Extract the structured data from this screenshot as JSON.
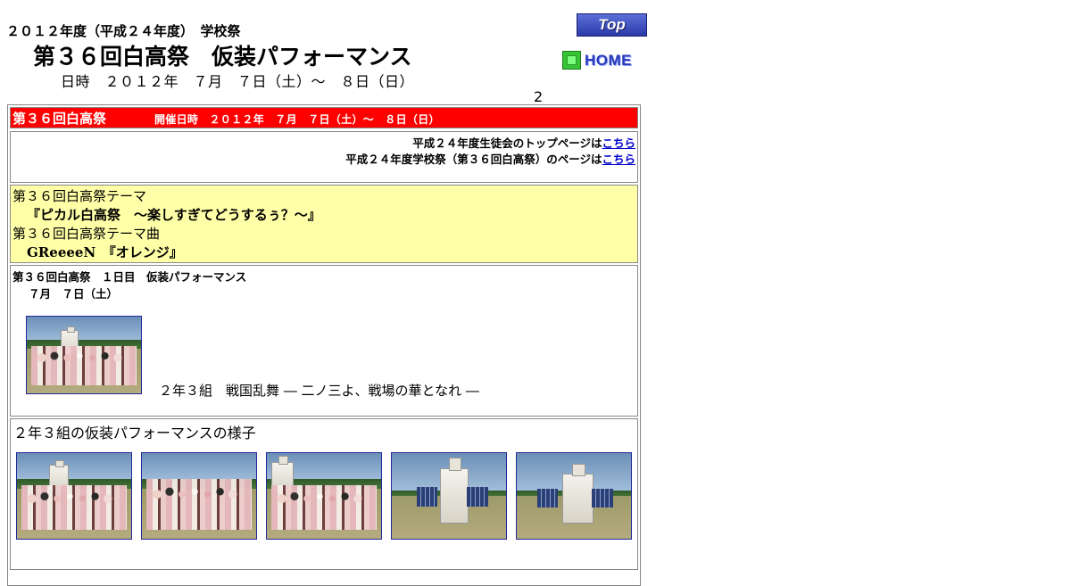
{
  "header": {
    "year_line": "２０１２年度（平成２４年度）　学校祭",
    "title": "第３６回白高祭　仮装パフォーマンス",
    "date_line": "日時　２０１２年　７月　７日（土）～　８日（日）",
    "counter": "2"
  },
  "nav": {
    "top_label": "Top",
    "home_label": "HOME"
  },
  "red_bar": {
    "title": "第３６回白高祭",
    "dates": "開催日時　２０１２年　７月　７日（土）～　８日（日）"
  },
  "links": {
    "row1_text": "平成２４年度生徒会のトップページは",
    "row1_link": "こちら",
    "row2_text": "平成２４年度学校祭（第３６回白高祭）のページは",
    "row2_link": "こちら"
  },
  "theme": {
    "theme_label": "第３６回白高祭テーマ",
    "theme_value": "『ピカル白高祭　～楽しすぎてどうするぅ？～』",
    "song_label": "第３６回白高祭テーマ曲",
    "song_artist": "GReeeeN",
    "song_title": "『オレンジ』"
  },
  "day1": {
    "heading": "第３６回白高祭　１日目　仮装パフォーマンス",
    "date": "７月　７日（土）",
    "caption": "２年３組　戦国乱舞 ― 二ノ三よ、戦場の華となれ ―"
  },
  "gallery": {
    "title": "２年３組の仮装パフォーマンスの様子",
    "photos": [
      "class-group-photo",
      "class-group-photo",
      "class-group-photo",
      "castle-prop-photo",
      "castle-prop-photo"
    ]
  },
  "colors": {
    "red_bar": "#ff0000",
    "theme_bg": "#ffffa8",
    "link": "#0000cc",
    "photo_border": "#222a99"
  }
}
